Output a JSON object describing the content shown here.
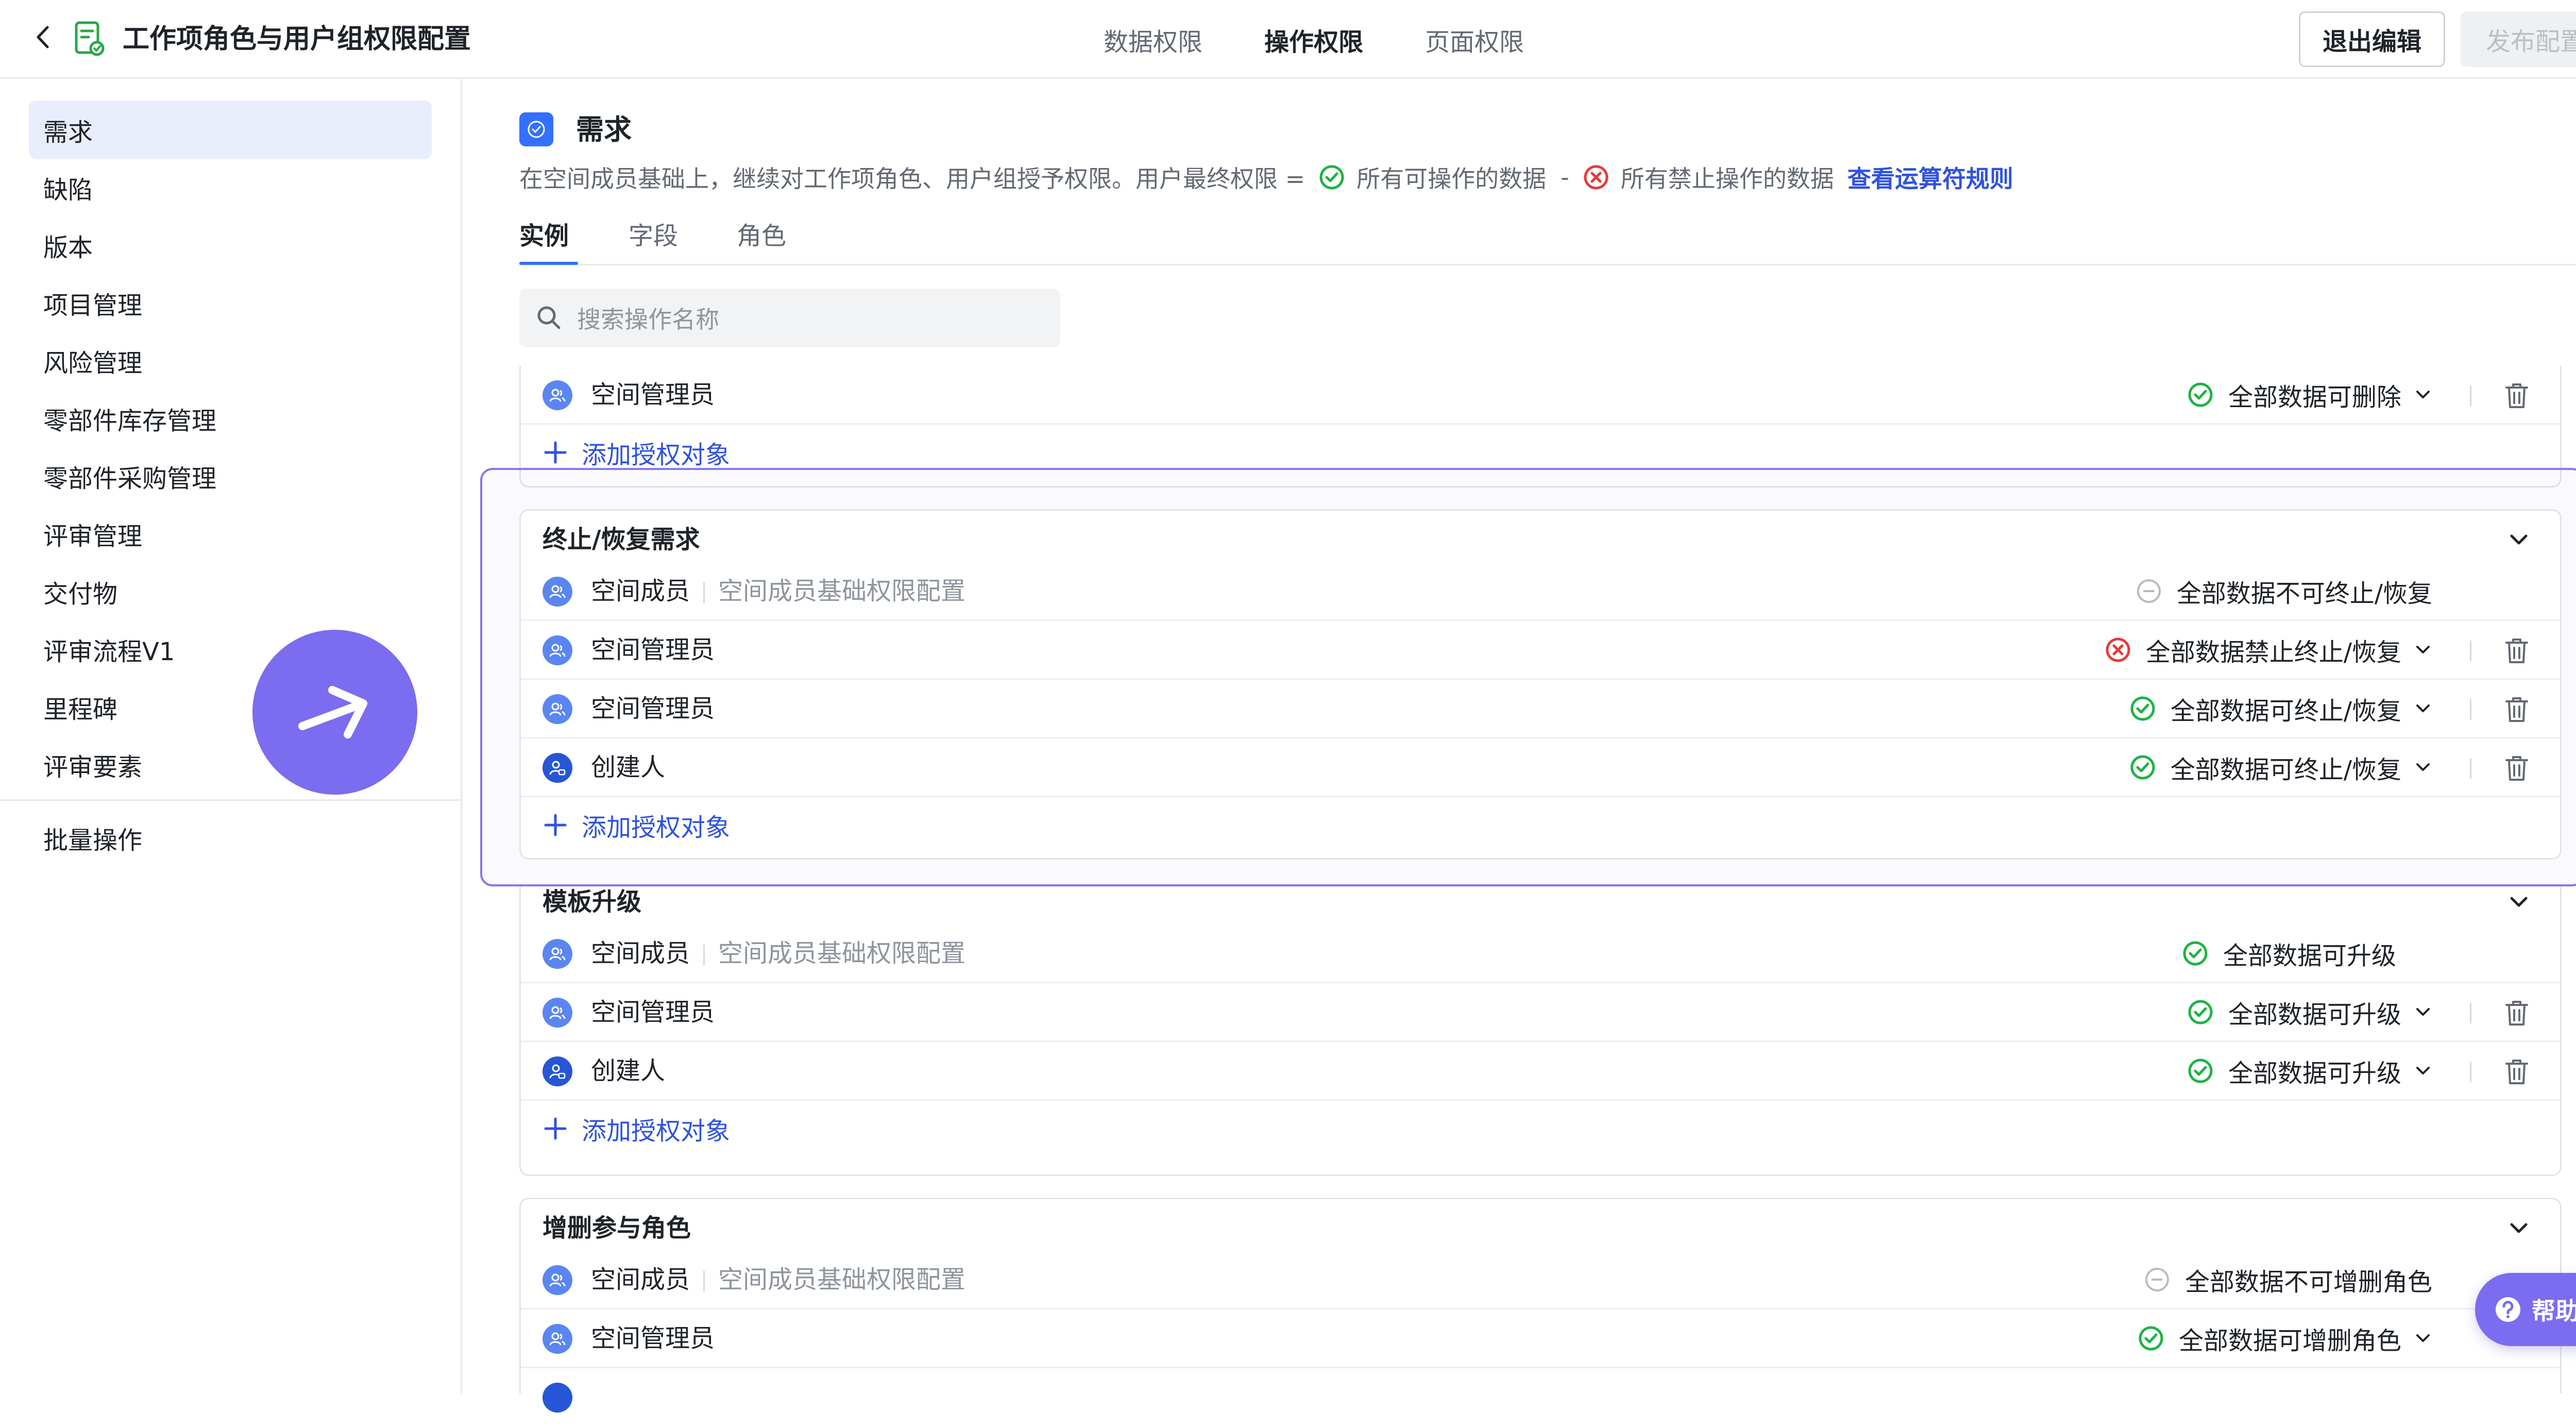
{
  "header": {
    "title": "工作项角色与用户组权限配置",
    "tabs": [
      {
        "label": "数据权限",
        "active": false
      },
      {
        "label": "操作权限",
        "active": true
      },
      {
        "label": "页面权限",
        "active": false
      }
    ],
    "exit_label": "退出编辑",
    "publish_label": "发布配置"
  },
  "sidebar": {
    "items": [
      {
        "label": "需求",
        "active": true
      },
      {
        "label": "缺陷"
      },
      {
        "label": "版本"
      },
      {
        "label": "项目管理"
      },
      {
        "label": "风险管理"
      },
      {
        "label": "零部件库存管理"
      },
      {
        "label": "零部件采购管理"
      },
      {
        "label": "评审管理"
      },
      {
        "label": "交付物"
      },
      {
        "label": "评审流程V1"
      },
      {
        "label": "里程碑"
      },
      {
        "label": "评审要素"
      }
    ],
    "batch_label": "批量操作"
  },
  "main": {
    "title": "需求",
    "description": {
      "prefix": "在空间成员基础上，继续对工作项角色、用户组授予权限。用户最终权限 =",
      "allowed": "所有可操作的数据",
      "minus": "-",
      "forbidden": "所有禁止操作的数据",
      "link": "查看运算符规则"
    },
    "subtabs": [
      {
        "label": "实例",
        "active": true
      },
      {
        "label": "字段"
      },
      {
        "label": "角色"
      }
    ],
    "search_placeholder": "搜索操作名称",
    "base_config_label": "空间成员基础权限配置",
    "add_label": "添加授权对象",
    "top_partial": {
      "rows": [
        {
          "subject": "空间管理员",
          "status": "allow",
          "perm": "全部数据可删除"
        }
      ]
    },
    "sections": [
      {
        "title": "终止/恢复需求",
        "rows": [
          {
            "subject": "空间成员",
            "status": "none",
            "perm": "全部数据不可终止/恢复"
          },
          {
            "subject": "空间管理员",
            "status": "deny",
            "perm": "全部数据禁止终止/恢复"
          },
          {
            "subject": "空间管理员",
            "status": "allow",
            "perm": "全部数据可终止/恢复"
          },
          {
            "subject": "创建人",
            "status": "allow",
            "perm": "全部数据可终止/恢复"
          }
        ]
      },
      {
        "title": "模板升级",
        "rows": [
          {
            "subject": "空间成员",
            "status": "allow",
            "perm": "全部数据可升级"
          },
          {
            "subject": "空间管理员",
            "status": "allow",
            "perm": "全部数据可升级"
          },
          {
            "subject": "创建人",
            "status": "allow",
            "perm": "全部数据可升级"
          }
        ]
      },
      {
        "title": "增删参与角色",
        "rows": [
          {
            "subject": "空间成员",
            "status": "none",
            "perm": "全部数据不可增删角色"
          },
          {
            "subject": "空间管理员",
            "status": "allow",
            "perm": "全部数据可增删角色"
          }
        ]
      }
    ]
  },
  "help_label": "帮助",
  "colors": {
    "accent": "#3370ff",
    "link": "#3052e0",
    "allow": "#1eb343",
    "deny": "#e23b3b",
    "highlight": "#8878f0"
  }
}
